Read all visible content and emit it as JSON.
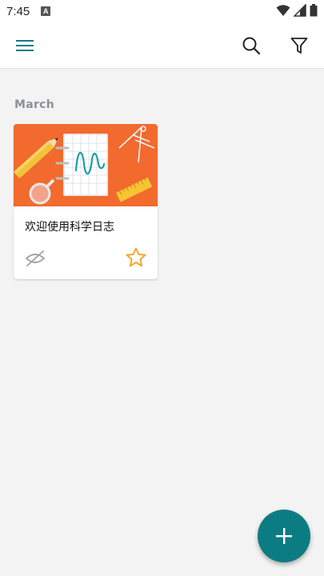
{
  "status_bar": {
    "time": "7:45",
    "notification_icon": "a-icon"
  },
  "app_bar": {
    "menu_icon": "menu-icon",
    "search_icon": "search-icon",
    "filter_icon": "filter-icon"
  },
  "section": {
    "title": "March"
  },
  "cards": [
    {
      "title": "欢迎使用科学日志",
      "visibility_icon": "hidden-icon",
      "favorite_icon": "star-icon"
    }
  ],
  "fab": {
    "icon": "add-icon"
  },
  "colors": {
    "accent": "#0c7c83",
    "card_banner": "#f26a2e",
    "star": "#f3a52d",
    "section_title": "#8a9197"
  }
}
